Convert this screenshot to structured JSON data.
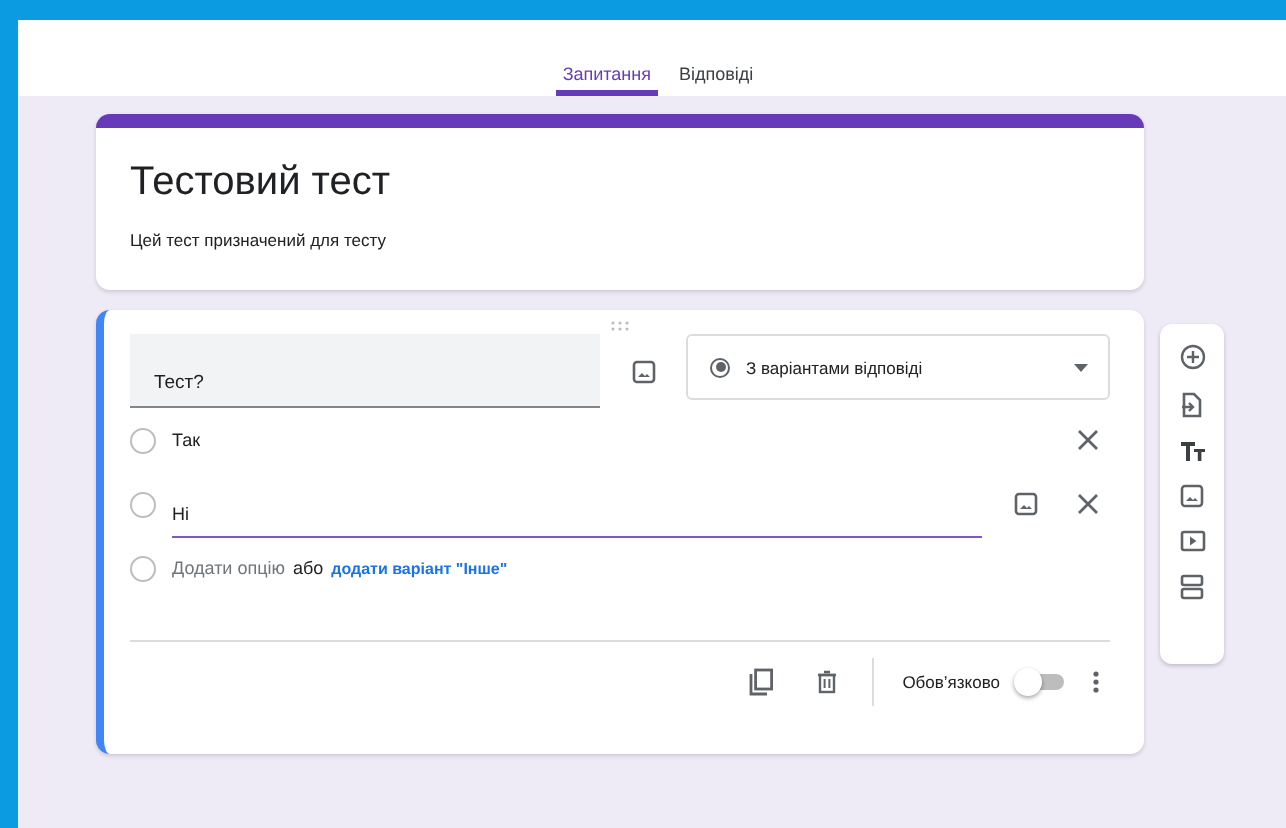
{
  "tabs": [
    {
      "label": "Запитання",
      "selected": true
    },
    {
      "label": "Відповіді",
      "selected": false
    }
  ],
  "form_header": {
    "title": "Тестовий тест",
    "description": "Цей тест призначений для тесту"
  },
  "question": {
    "title": "Тест?",
    "type": "З варіантами відповіді",
    "options": [
      {
        "label": "Так",
        "focused": false
      },
      {
        "label": "Ні",
        "focused": true
      }
    ],
    "add_option": "Додати опцію",
    "or": "або",
    "add_other": "додати варіант \"Інше\"",
    "required_label": "Обов’язково",
    "required": false
  }
}
